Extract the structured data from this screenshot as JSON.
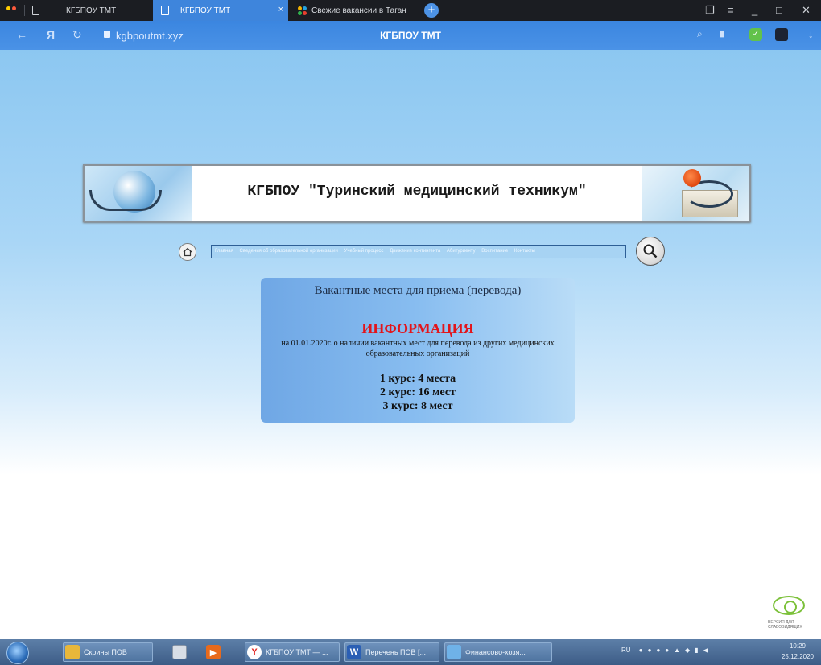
{
  "browser": {
    "tabs": [
      {
        "label": "КГБПОУ ТМТ",
        "active": false
      },
      {
        "label": "КГБПОУ ТМТ",
        "active": true
      },
      {
        "label": "Свежие вакансии в Таган",
        "active": false
      }
    ],
    "close_symbol": "×",
    "plus_symbol": "+",
    "address": "kgbpoutmt.xyz",
    "page_title": "КГБПОУ ТМТ",
    "accent_color": "#3e85dc"
  },
  "page": {
    "banner_title": "КГБПОУ \"Туринский медицинский техникум\"",
    "nav_items": [
      "Главная",
      "Сведения об образовательной организации",
      "Учебный процесс",
      "Движение контингента",
      "Абитуриенту",
      "Воспитание",
      "Контакты"
    ],
    "card": {
      "title": "Вакантные места для приема (перевода)",
      "info_heading": "ИНФОРМАЦИЯ",
      "info_text": "на 01.01.2020г. о наличии вакантных мест для перевода из других медицинских образовательных организаций",
      "courses": [
        "1 курс: 4 места",
        "2 курс: 16 мест",
        "3 курс: 8 мест"
      ]
    },
    "watermark_text": "ВЕРСИЯ ДЛЯ СЛАБОВИДЯЩИХ"
  },
  "taskbar": {
    "items": [
      "Скрины ПОВ",
      "КГБПОУ ТМТ — ...",
      "Перечень ПОВ [...",
      "Финансово-хозя..."
    ],
    "tray_lang": "RU",
    "time": "10:29",
    "date": "25.12.2020"
  }
}
